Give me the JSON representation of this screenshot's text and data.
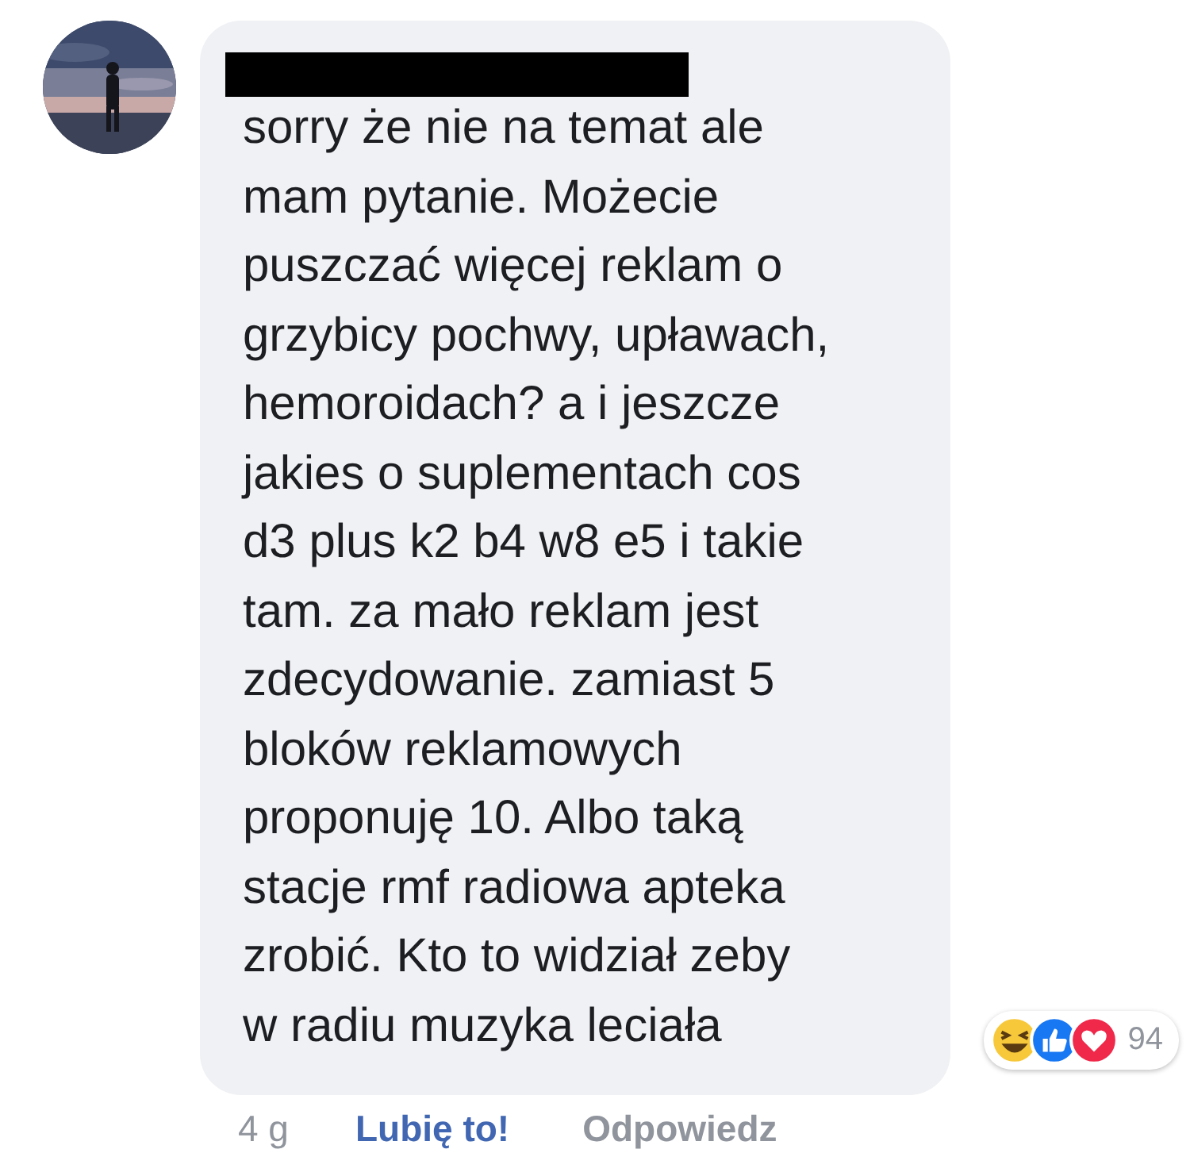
{
  "comment": {
    "author_redacted": true,
    "lines": [
      "sorry że nie na temat ale",
      "mam pytanie. Możecie",
      "puszczać więcej reklam o",
      "grzybicy pochwy, upławach,",
      "hemoroidach? a i jeszcze",
      "jakies o suplementach cos",
      "d3 plus k2 b4 w8 e5 i takie",
      "tam. za mało reklam jest",
      "zdecydowanie. zamiast 5",
      "bloków reklamowych",
      "proponuję 10. Albo taką",
      "stacje rmf radiowa apteka",
      "zrobić. Kto to widział zeby",
      "w radiu muzyka leciała"
    ],
    "reactions": {
      "types": [
        {
          "kind": "haha"
        },
        {
          "kind": "like"
        },
        {
          "kind": "love"
        }
      ],
      "count": "94"
    },
    "footer": {
      "time": "4 g",
      "like": "Lubię to!",
      "reply": "Odpowiedz"
    }
  }
}
